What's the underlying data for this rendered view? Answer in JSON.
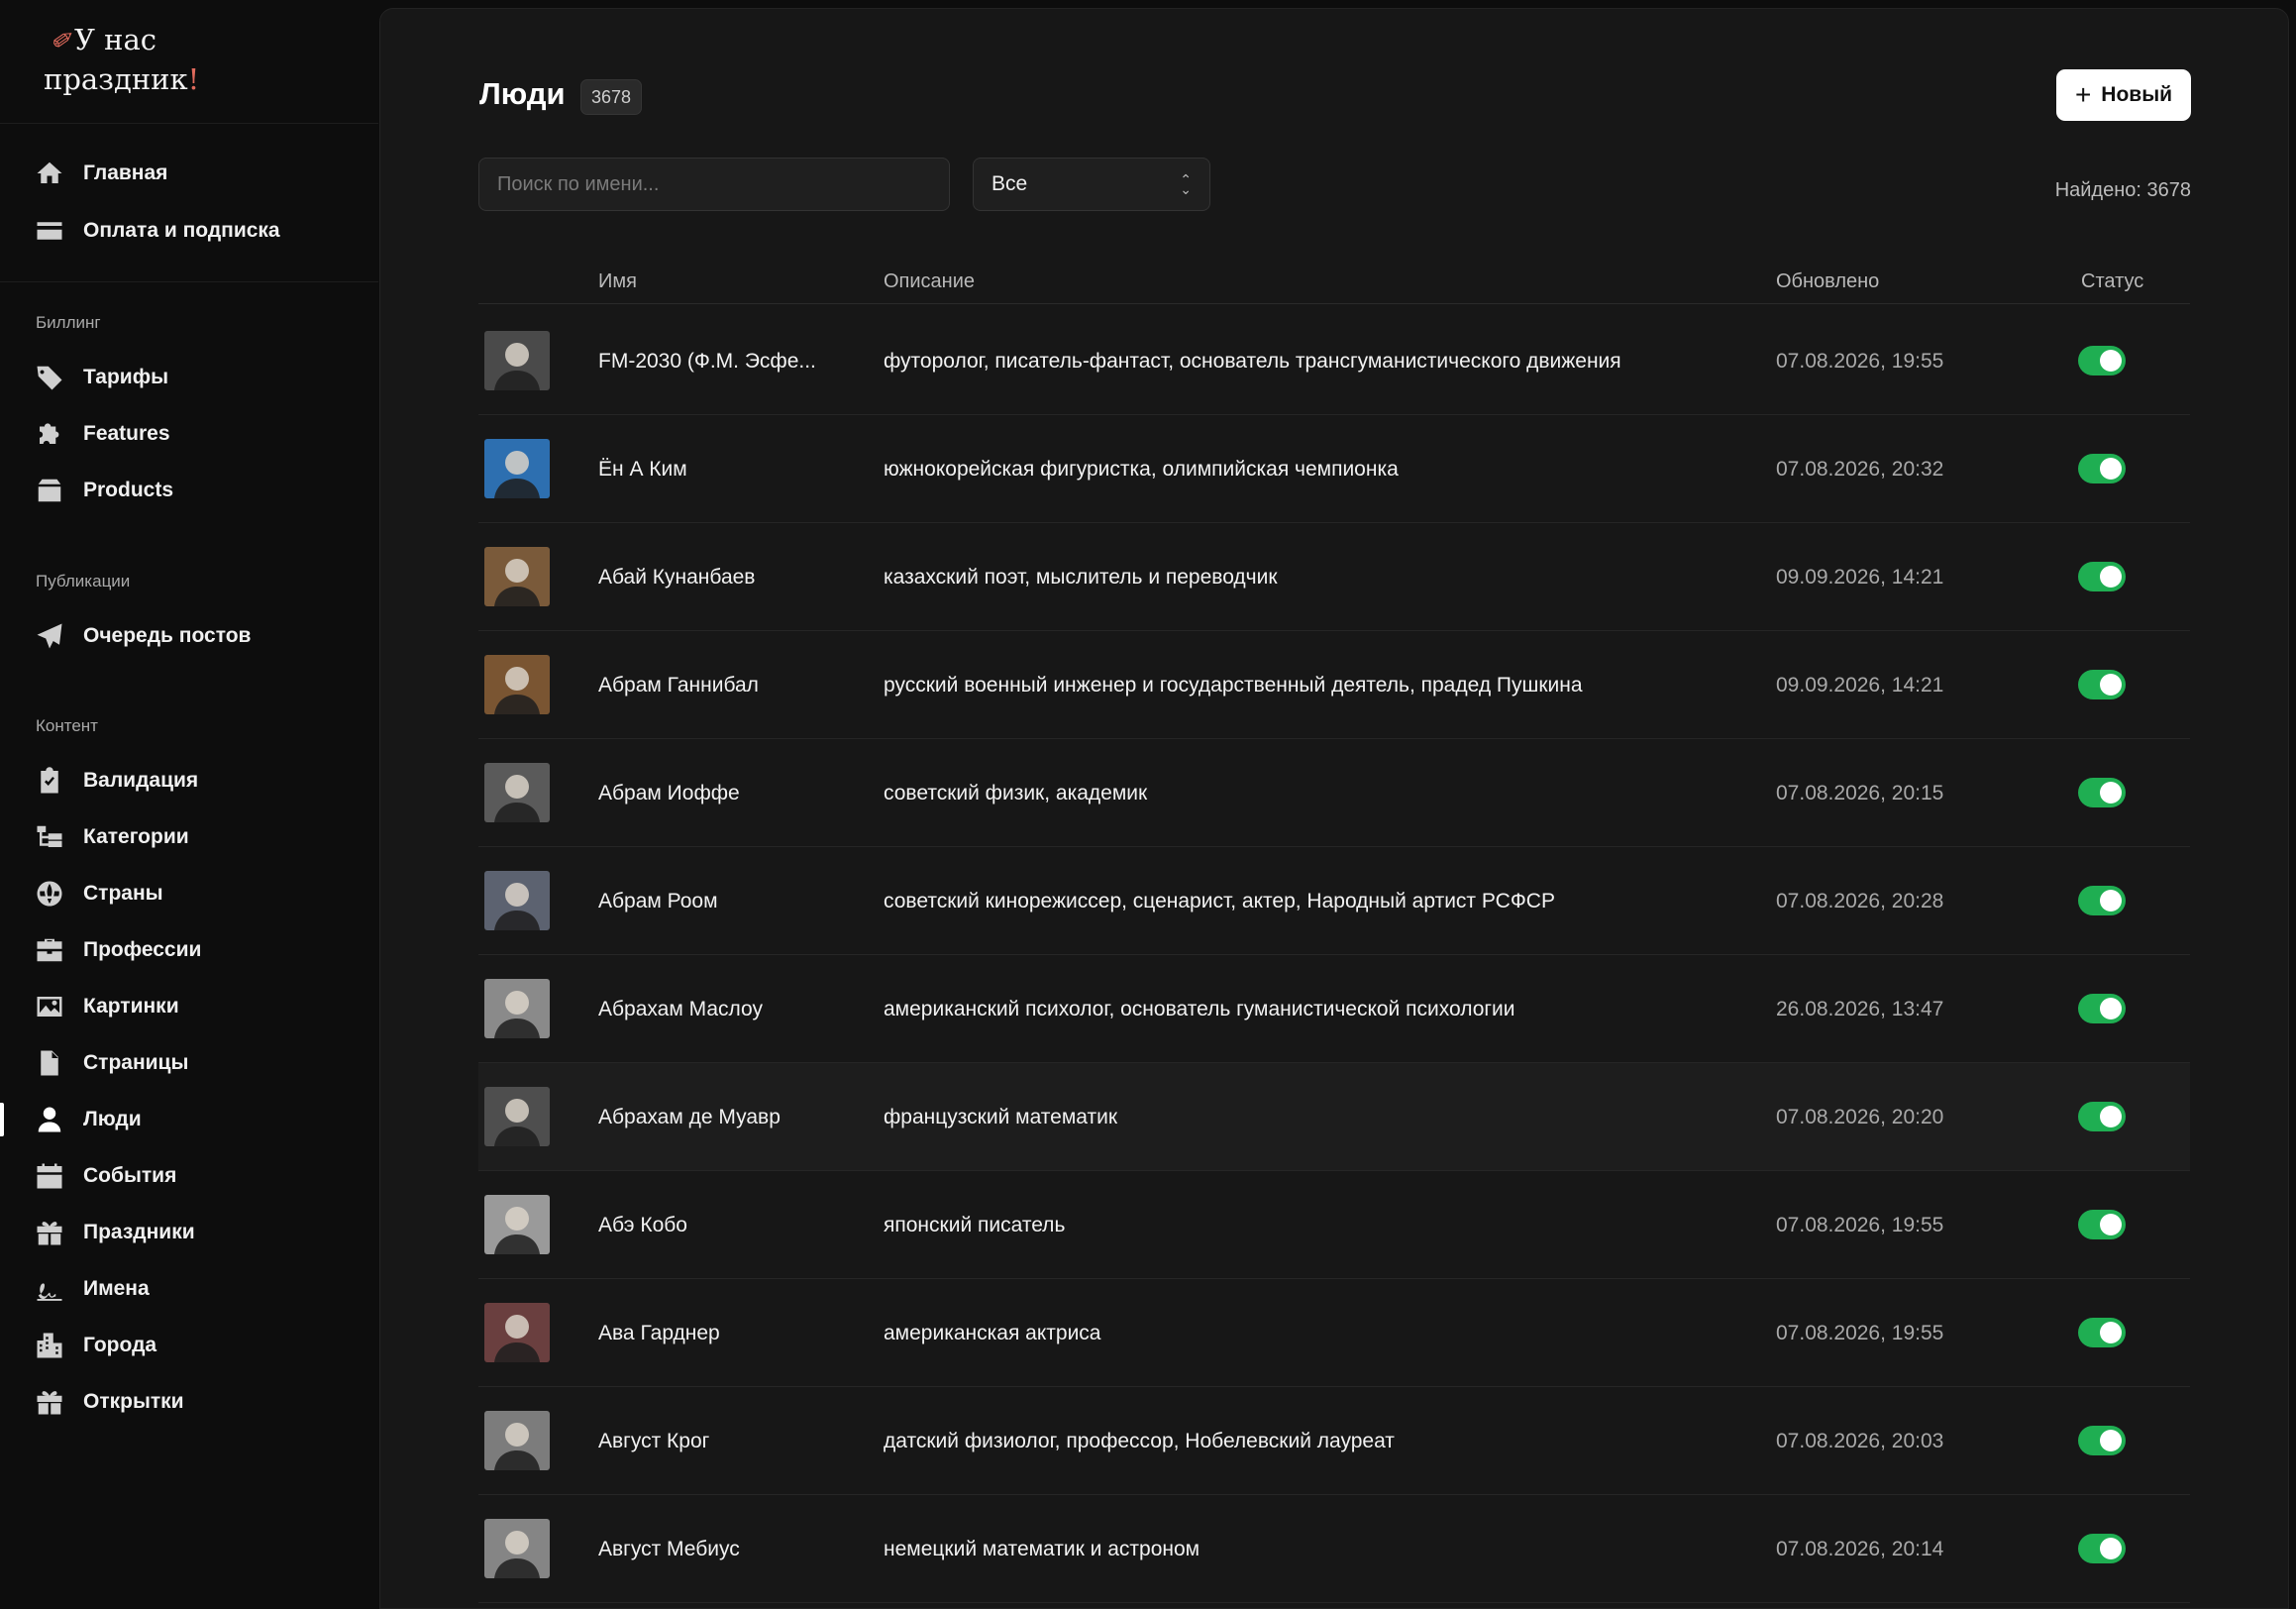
{
  "brand": {
    "line1": "У нас",
    "line2": "праздник",
    "bang": "!"
  },
  "nav_top": [
    {
      "label": "Главная",
      "icon": "home-icon"
    },
    {
      "label": "Оплата и подписка",
      "icon": "credit-card-icon"
    }
  ],
  "sections": [
    {
      "title": "Биллинг",
      "items": [
        {
          "label": "Тарифы",
          "icon": "tags-icon"
        },
        {
          "label": "Features",
          "icon": "puzzle-icon"
        },
        {
          "label": "Products",
          "icon": "box-icon"
        }
      ]
    },
    {
      "title": "Публикации",
      "items": [
        {
          "label": "Очередь постов",
          "icon": "paper-plane-icon"
        }
      ]
    },
    {
      "title": "Контент",
      "items": [
        {
          "label": "Валидация",
          "icon": "clipboard-check-icon"
        },
        {
          "label": "Категории",
          "icon": "sitemap-icon"
        },
        {
          "label": "Страны",
          "icon": "globe-icon"
        },
        {
          "label": "Профессии",
          "icon": "briefcase-icon"
        },
        {
          "label": "Картинки",
          "icon": "image-icon"
        },
        {
          "label": "Страницы",
          "icon": "file-icon"
        },
        {
          "label": "Люди",
          "icon": "user-icon",
          "active": true
        },
        {
          "label": "События",
          "icon": "calendar-icon"
        },
        {
          "label": "Праздники",
          "icon": "gift-icon"
        },
        {
          "label": "Имена",
          "icon": "signature-icon"
        },
        {
          "label": "Города",
          "icon": "city-icon"
        },
        {
          "label": "Открытки",
          "icon": "gift-card-icon"
        }
      ]
    }
  ],
  "header": {
    "title": "Люди",
    "count": "3678",
    "new_label": "Новый"
  },
  "filters": {
    "search_placeholder": "Поиск по имени...",
    "select_value": "Все",
    "found": "Найдено: 3678"
  },
  "columns": {
    "name": "Имя",
    "description": "Описание",
    "updated": "Обновлено",
    "status": "Статус"
  },
  "rows": [
    {
      "name": "FM-2030 (Ф.М. Эсфе...",
      "desc": "футоролог, писатель-фантаст, основатель трансгуманистического движения",
      "date": "07.08.2026, 19:55",
      "status": true
    },
    {
      "name": "Ён А Ким",
      "desc": "южнокорейская фигуристка, олимпийская чемпионка",
      "date": "07.08.2026, 20:32",
      "status": true
    },
    {
      "name": "Абай Кунанбаев",
      "desc": "казахский поэт, мыслитель и переводчик",
      "date": "09.09.2026, 14:21",
      "status": true
    },
    {
      "name": "Абрам Ганнибал",
      "desc": "русский военный инженер и государственный деятель, прадед Пушкина",
      "date": "09.09.2026, 14:21",
      "status": true
    },
    {
      "name": "Абрам Иоффе",
      "desc": "советский физик, академик",
      "date": "07.08.2026, 20:15",
      "status": true
    },
    {
      "name": "Абрам Роом",
      "desc": "советский кинорежиссер, сценарист, актер, Народный артист РСФСР",
      "date": "07.08.2026, 20:28",
      "status": true
    },
    {
      "name": "Абрахам Маслоу",
      "desc": "американский психолог, основатель гуманистической психологии",
      "date": "26.08.2026, 13:47",
      "status": true
    },
    {
      "name": "Абрахам де Муавр",
      "desc": "французский математик",
      "date": "07.08.2026, 20:20",
      "status": true
    },
    {
      "name": "Абэ Кобо",
      "desc": "японский писатель",
      "date": "07.08.2026, 19:55",
      "status": true
    },
    {
      "name": "Ава Гарднер",
      "desc": "американская актриса",
      "date": "07.08.2026, 19:55",
      "status": true
    },
    {
      "name": "Август Крог",
      "desc": "датский физиолог, профессор, Нобелевский лауреат",
      "date": "07.08.2026, 20:03",
      "status": true
    },
    {
      "name": "Август Мебиус",
      "desc": "немецкий математик и астроном",
      "date": "07.08.2026, 20:14",
      "status": true
    }
  ],
  "colors": {
    "accent_toggle": "#1fae52",
    "brand_accent": "#e06a5c",
    "panel": "#171717",
    "sidebar": "#0d0d0d"
  }
}
